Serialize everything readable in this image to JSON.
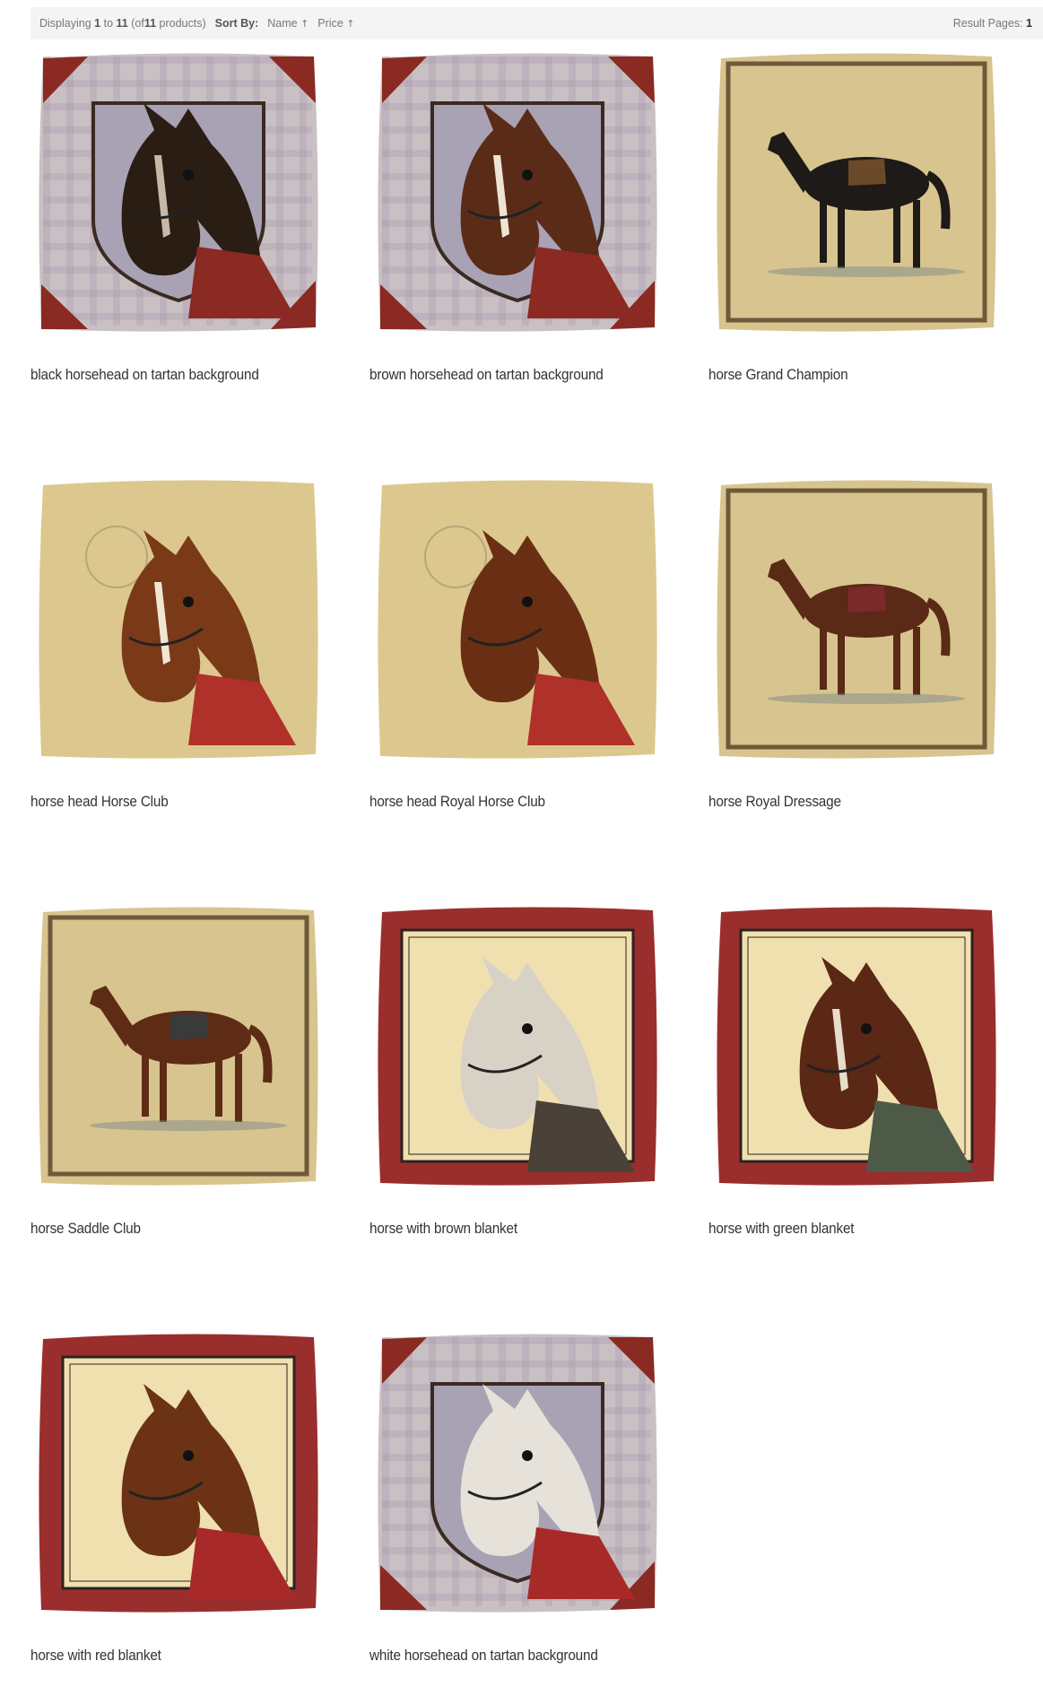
{
  "listing": {
    "displaying_prefix": "Displaying",
    "from": "1",
    "to_word": "to",
    "to": "11",
    "of_prefix": "(of",
    "total": "11",
    "of_suffix": "products)",
    "sort_by_label": "Sort By:",
    "sort_name": "Name",
    "sort_price": "Price",
    "sort_arrow": "↑",
    "result_pages_label": "Result Pages:",
    "current_page": "1"
  },
  "products": [
    {
      "title": "black horsehead on tartan background",
      "style": "tartan",
      "horse": "#2a1d14",
      "blaze": "#c8b8a8",
      "accent": "#8a2a22",
      "icon": "horse-head-icon"
    },
    {
      "title": "brown horsehead on tartan background",
      "style": "tartan",
      "horse": "#5a2c17",
      "blaze": "#efe4d4",
      "accent": "#8a2a22",
      "icon": "horse-head-icon"
    },
    {
      "title": "horse Grand Champion",
      "style": "full",
      "horse": "#1e1a18",
      "blaze": "#1e1a18",
      "accent": "#6b4a2a",
      "icon": "horse-icon"
    },
    {
      "title": "horse head Horse Club",
      "style": "head-plain",
      "horse": "#7a3a18",
      "blaze": "#f1e6d2",
      "accent": "#b0302a",
      "icon": "horse-head-icon"
    },
    {
      "title": "horse head Royal Horse Club",
      "style": "head-plain",
      "horse": "#6a2e14",
      "blaze": "#6a2e14",
      "accent": "#b0302a",
      "icon": "horse-head-icon"
    },
    {
      "title": "horse Royal Dressage",
      "style": "full",
      "horse": "#5a2a16",
      "blaze": "#5a2a16",
      "accent": "#7a2a2a",
      "icon": "horse-icon"
    },
    {
      "title": "horse Saddle Club",
      "style": "full",
      "horse": "#5e2c15",
      "blaze": "#5e2c15",
      "accent": "#3a3a3a",
      "icon": "horse-icon"
    },
    {
      "title": "horse with brown blanket",
      "style": "red-frame",
      "horse": "#d8d2c6",
      "blaze": "#d8d2c6",
      "accent": "#4a4238",
      "icon": "horse-head-icon"
    },
    {
      "title": "horse with green blanket",
      "style": "red-frame",
      "horse": "#5a2814",
      "blaze": "#e8dccb",
      "accent": "#4e5a48",
      "icon": "horse-head-icon"
    },
    {
      "title": "horse with red blanket",
      "style": "red-frame",
      "horse": "#6c3216",
      "blaze": "#6c3216",
      "accent": "#a82a28",
      "icon": "horse-head-icon"
    },
    {
      "title": "white horsehead on tartan background",
      "style": "tartan",
      "horse": "#e6e2da",
      "blaze": "#e6e2da",
      "accent": "#a82a28",
      "icon": "horse-head-icon"
    }
  ]
}
